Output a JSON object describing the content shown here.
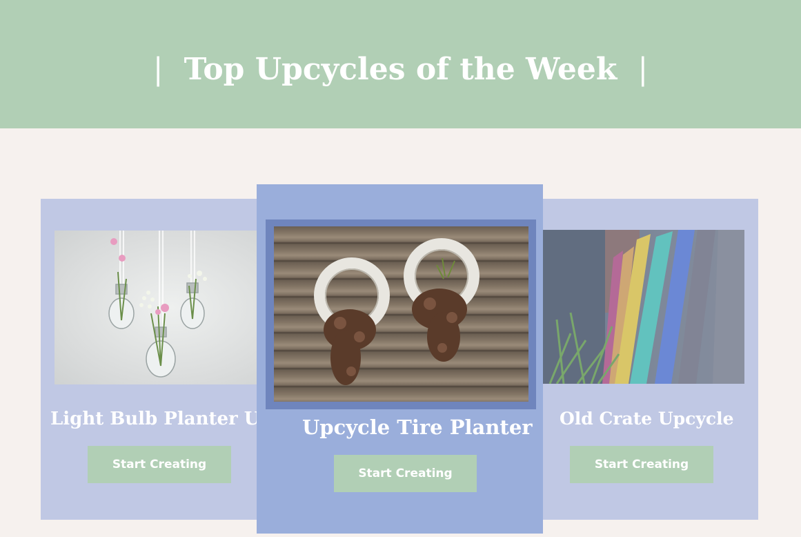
{
  "header": {
    "title": "Top Upcycles of the Week",
    "divider": "|"
  },
  "cards": [
    {
      "title": "Light Bulb Planter Upcycle",
      "image_alt": "light bulbs hanging with flowers",
      "button_label": "Start Creating"
    },
    {
      "title": "Upcycle Tire Planter",
      "image_alt": "white tires on wooden wall with plants",
      "button_label": "Start Creating"
    },
    {
      "title": "Old Crate Upcycle",
      "image_alt": "colorful painted wooden slats",
      "button_label": "Start Creating"
    }
  ],
  "colors": {
    "banner": "#b1cfb5",
    "page_background": "#f6f1ee",
    "side_card": "#c0c8e4",
    "center_card": "#9aaedb",
    "button": "#b1cfb5"
  }
}
